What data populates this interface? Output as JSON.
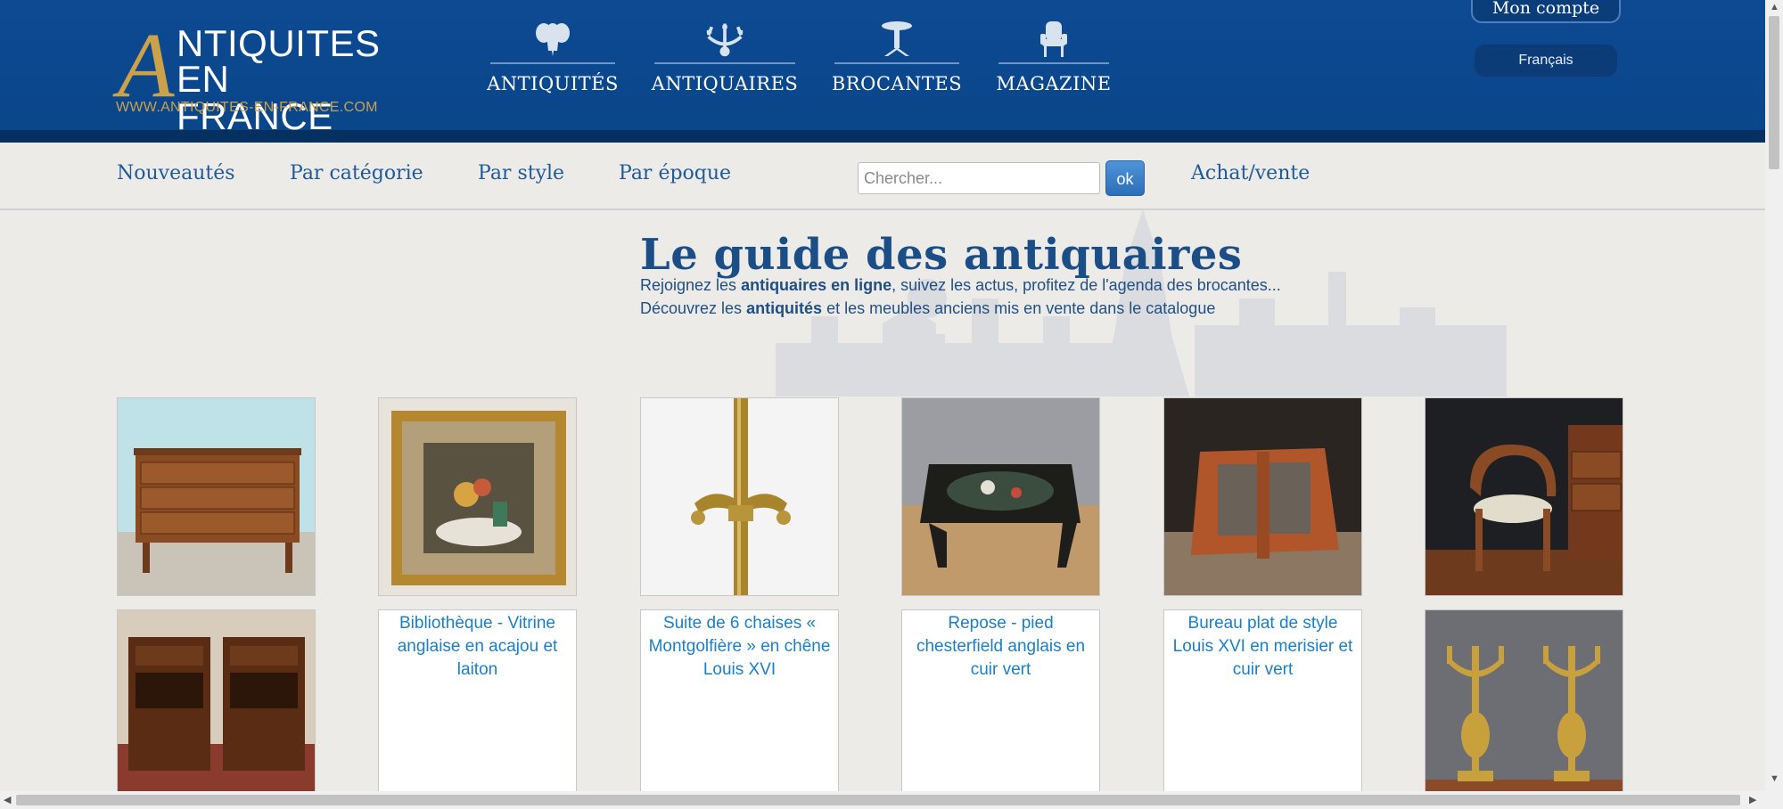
{
  "logo": {
    "letter": "A",
    "line1": "NTIQUITES",
    "line2": "EN FRANCE",
    "url": "WWW.ANTIQUITES-EN-FRANCE.COM"
  },
  "main_nav": [
    {
      "label": "ANTIQUITÉS",
      "icon": "cherub-icon"
    },
    {
      "label": "ANTIQUAIRES",
      "icon": "chandelier-icon"
    },
    {
      "label": "BROCANTES",
      "icon": "pedestal-table-icon"
    },
    {
      "label": "MAGAZINE",
      "icon": "armchair-icon"
    }
  ],
  "account": {
    "label": "Mon compte",
    "language": "Français"
  },
  "sub_nav": {
    "links": [
      "Nouveautés",
      "Par catégorie",
      "Par style",
      "Par époque"
    ],
    "search_placeholder": "Chercher...",
    "search_button": "ok",
    "buy_sell": "Achat/vente"
  },
  "hero": {
    "title": "Le guide des antiquaires",
    "line1_pre": "Rejoignez les ",
    "line1_bold": "antiquaires en ligne",
    "line1_post": ", suivez les actus, profitez de l'agenda des brocantes...",
    "line2_pre": "Découvrez les ",
    "line2_bold": "antiquités",
    "line2_post": " et les meubles anciens mis en vente dans le catalogue"
  },
  "products": {
    "row1": [
      {
        "kind": "commode-image"
      },
      {
        "kind": "framed-painting-image"
      },
      {
        "kind": "brass-lamp-image"
      },
      {
        "kind": "lacquer-table-image"
      },
      {
        "kind": "wooden-stand-image"
      },
      {
        "kind": "cane-chair-image"
      }
    ],
    "row2": [
      {
        "kind": "nightstands-image"
      },
      {
        "alt": "Bibliothèque - Vitrine anglaise en acajou et laiton"
      },
      {
        "alt": "Suite de 6 chaises « Montgolfière » en chêne Louis XVI"
      },
      {
        "alt": "Repose - pied chesterfield anglais en cuir vert"
      },
      {
        "alt": "Bureau plat de style Louis XVI en merisier et cuir vert"
      },
      {
        "kind": "candelabra-image"
      }
    ]
  }
}
